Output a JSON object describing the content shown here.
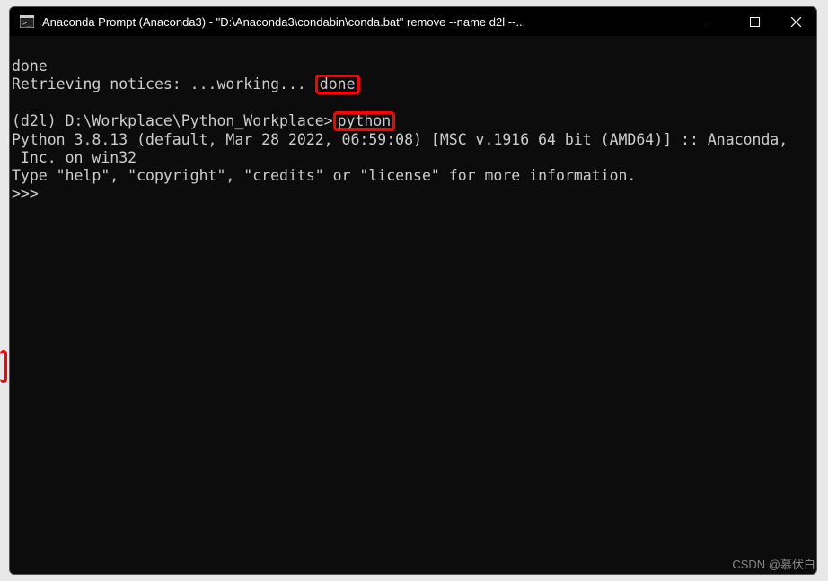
{
  "titlebar": {
    "title": "Anaconda Prompt (Anaconda3) - \"D:\\Anaconda3\\condabin\\conda.bat\"  remove --name d2l --..."
  },
  "terminal": {
    "line1": "done",
    "line2_pre": "Retrieving notices: ...working... ",
    "line2_hl": "done",
    "line3": "",
    "line4_pre": "(d2l) D:\\Workplace\\Python_Workplace>",
    "line4_hl": "python",
    "line5": "Python 3.8.13 (default, Mar 28 2022, 06:59:08) [MSC v.1916 64 bit (AMD64)] :: Anaconda,",
    "line6": " Inc. on win32",
    "line7": "Type \"help\", \"copyright\", \"credits\" or \"license\" for more information.",
    "line8": ">>>"
  },
  "watermark": "CSDN @慕伏白"
}
